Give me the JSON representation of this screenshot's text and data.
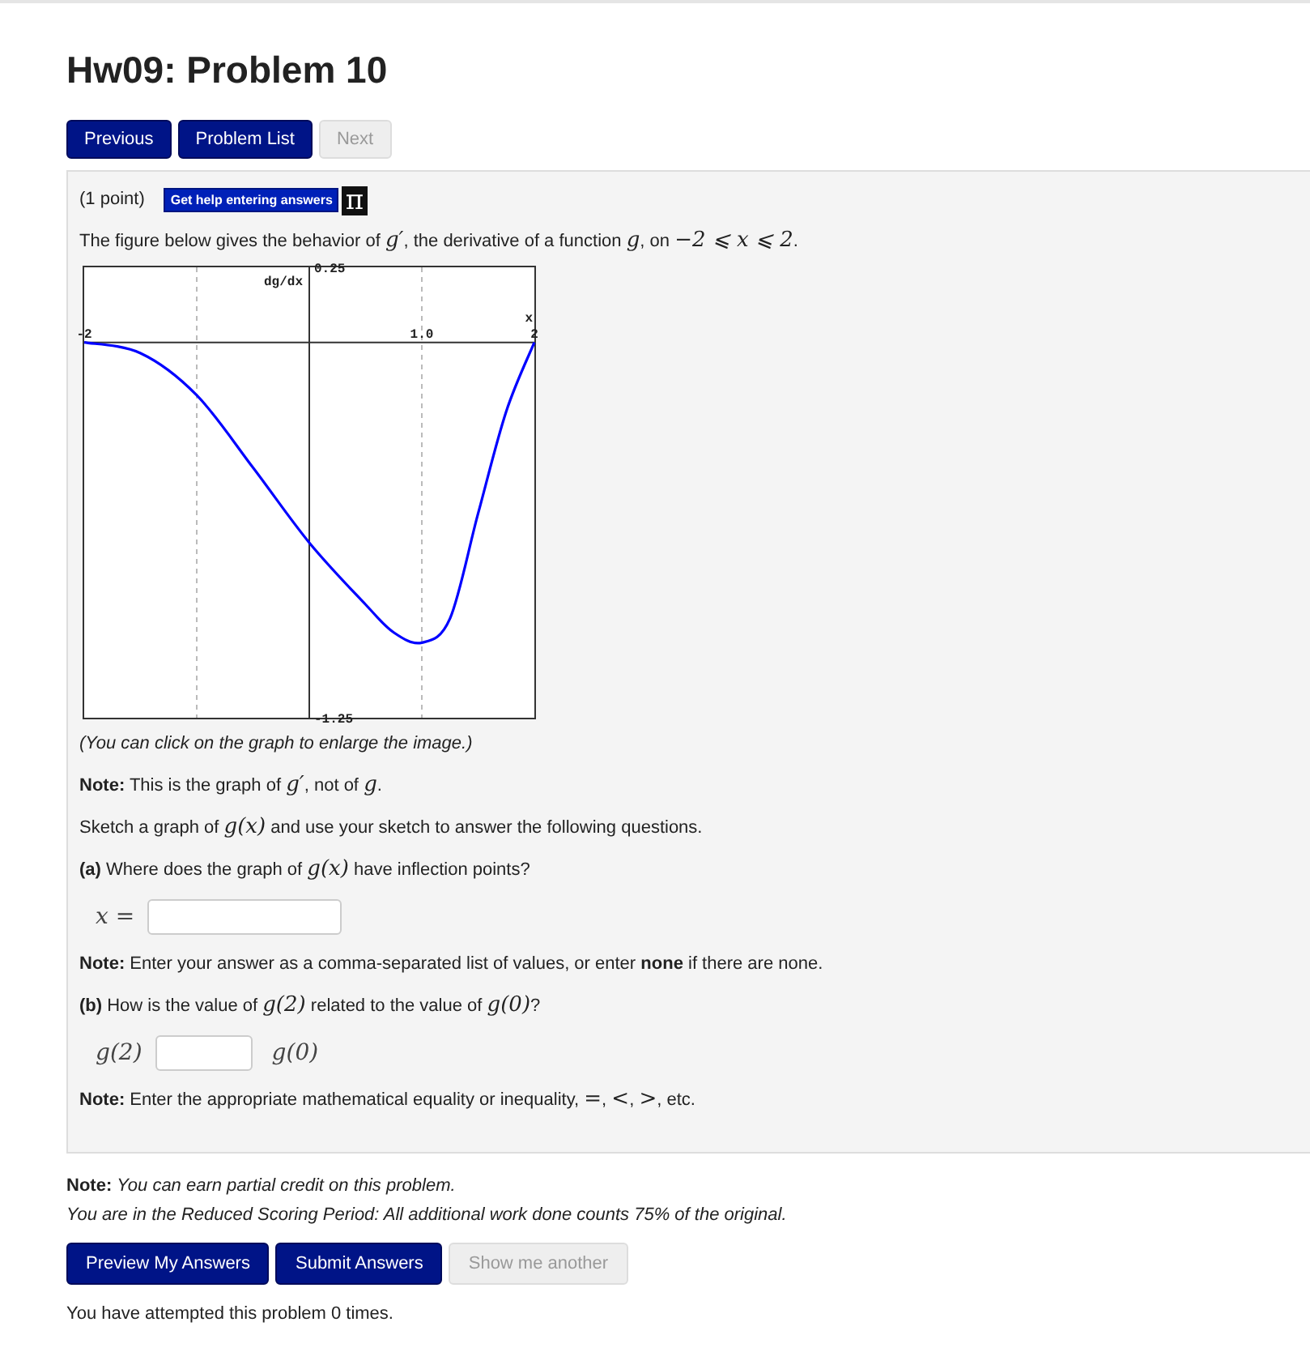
{
  "title": "Hw09: Problem 10",
  "nav_buttons": [
    {
      "label": "Previous",
      "disabled": false
    },
    {
      "label": "Problem List",
      "disabled": false
    },
    {
      "label": "Next",
      "disabled": true
    }
  ],
  "problem": {
    "points": "(1 point)",
    "help_button": "Get help entering answers",
    "help_icon": "π",
    "intro": [
      {
        "kind": "text",
        "t": "The figure below gives the behavior of "
      },
      {
        "kind": "math",
        "t": "g′"
      },
      {
        "kind": "text",
        "t": ", the derivative of a function "
      },
      {
        "kind": "math",
        "t": "g"
      },
      {
        "kind": "text",
        "t": ", on "
      },
      {
        "kind": "math",
        "t": "−2 ⩽ x ⩽ 2"
      },
      {
        "kind": "text",
        "t": "."
      }
    ],
    "chart_data": {
      "type": "line",
      "xlabel": "x",
      "ylabel": "dg/dx",
      "xlim": [
        -2,
        2
      ],
      "ylim": [
        -1.25,
        0.25
      ],
      "xticks": [
        -2,
        {
          "value": 1,
          "label": "1.0"
        },
        2
      ],
      "yticks": [
        {
          "value": 0.25,
          "label": "0.25"
        },
        {
          "value": -1.25,
          "label": "-1.25"
        }
      ],
      "x": [
        -2,
        -1.5,
        -1,
        -0.5,
        0,
        0.5,
        0.75,
        1,
        1.25,
        1.5,
        1.75,
        2
      ],
      "series": [
        {
          "color": "#0000ff",
          "values": [
            0,
            -0.036,
            -0.176,
            -0.417,
            -0.667,
            -0.873,
            -0.966,
            -1.0,
            -0.92,
            -0.57,
            -0.23,
            0
          ]
        }
      ]
    },
    "caption": "(You can click on the graph to enlarge the image.)",
    "paragraphs": [
      [
        {
          "kind": "text",
          "t": "**Note:** This is the graph of "
        },
        {
          "kind": "math",
          "t": "g′"
        },
        {
          "kind": "text",
          "t": ", not of "
        },
        {
          "kind": "math",
          "t": "g"
        },
        {
          "kind": "text",
          "t": "."
        }
      ],
      [
        {
          "kind": "text",
          "t": "Sketch a graph of "
        },
        {
          "kind": "math",
          "t": "g(x)"
        },
        {
          "kind": "text",
          "t": " and use your sketch to answer the following questions."
        }
      ],
      [
        {
          "kind": "text",
          "t": "**(a)** Where does the graph of "
        },
        {
          "kind": "math",
          "t": "g(x)"
        },
        {
          "kind": "text",
          "t": " have inflection points?"
        }
      ],
      {
        "kind": "answer",
        "before": "x ="
      },
      [
        {
          "kind": "text",
          "t": "**Note:** Enter your answer as a comma-separated list of values, or enter **none** if there are none."
        }
      ],
      [
        {
          "kind": "text",
          "t": "**(b)** How is the value of "
        },
        {
          "kind": "math",
          "t": "g(2)"
        },
        {
          "kind": "text",
          "t": " related to the value of "
        },
        {
          "kind": "math",
          "t": "g(0)"
        },
        {
          "kind": "text",
          "t": "?"
        }
      ],
      {
        "kind": "answer",
        "before": "g(2)",
        "after": "g(0)"
      },
      [
        {
          "kind": "text",
          "t": "**Note:** Enter the appropriate mathematical equality or inequality, "
        },
        {
          "kind": "math",
          "t": "="
        },
        {
          "kind": "text",
          "t": ", "
        },
        {
          "kind": "math",
          "t": "<"
        },
        {
          "kind": "text",
          "t": ", "
        },
        {
          "kind": "math",
          "t": ">"
        },
        {
          "kind": "text",
          "t": ", etc."
        }
      ]
    ]
  },
  "notes": [
    "**Note:** *You can earn partial credit on this problem.*",
    "*You are in the Reduced Scoring Period: All additional work done counts 75% of the original.*"
  ],
  "action_buttons": [
    {
      "label": "Preview My Answers",
      "disabled": false
    },
    {
      "label": "Submit Answers",
      "disabled": false
    },
    {
      "label": "Show me another",
      "disabled": true
    }
  ],
  "attempts": "You have attempted this problem 0 times."
}
